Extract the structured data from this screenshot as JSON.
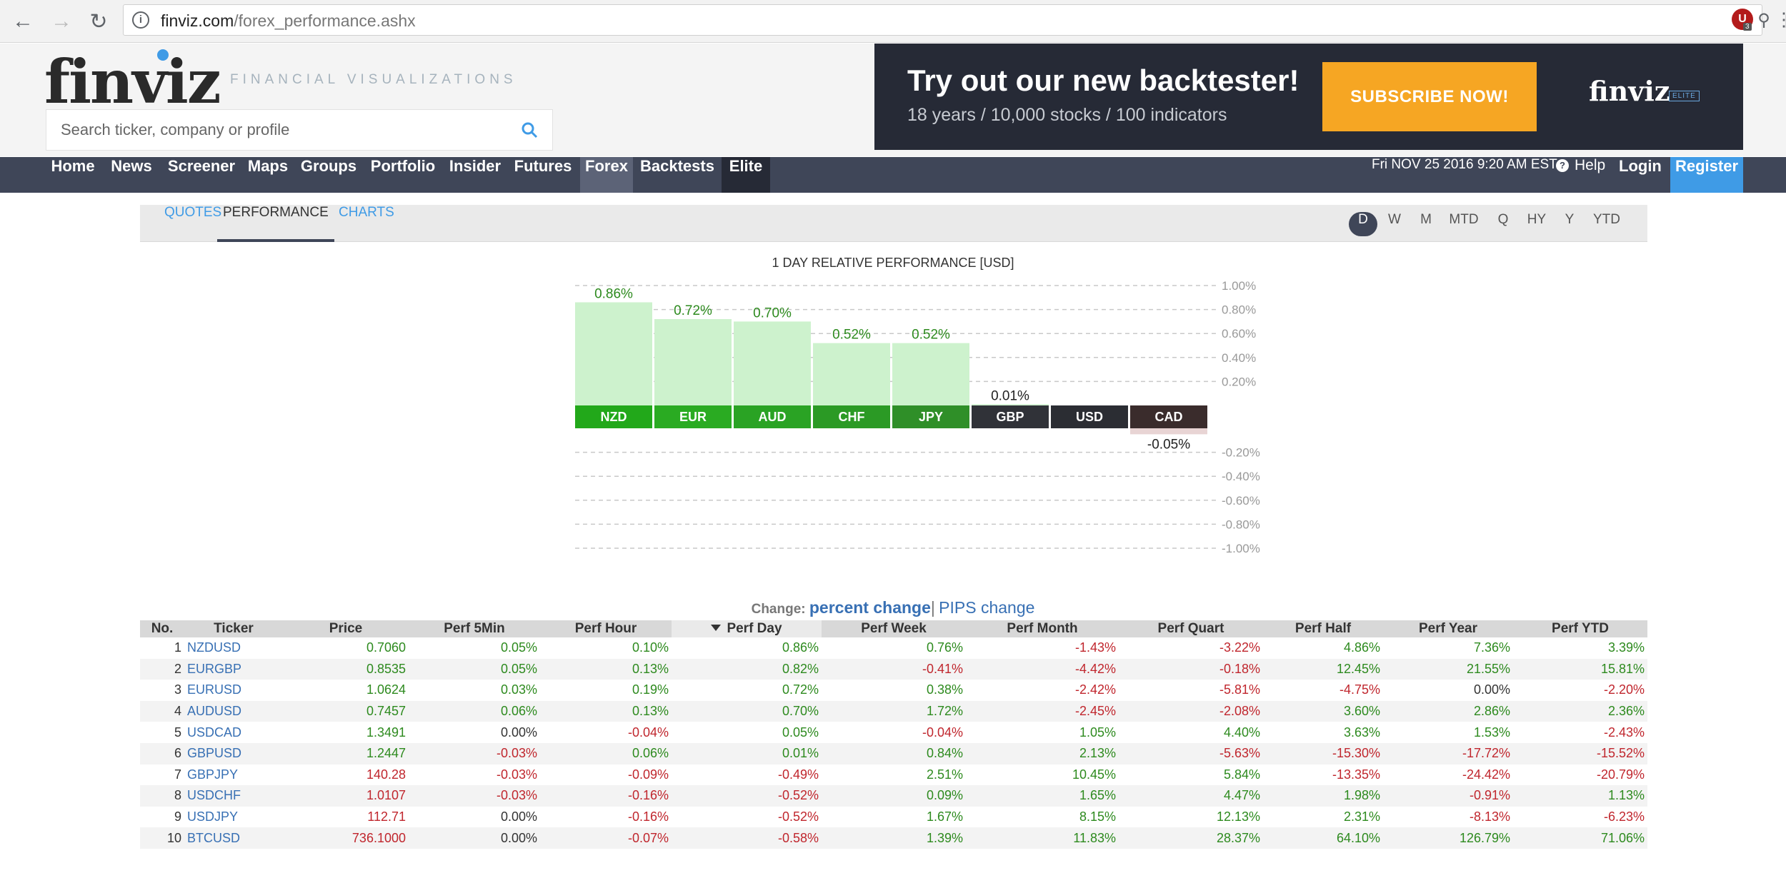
{
  "browser": {
    "url_host": "finviz.com",
    "url_path": "/forex_performance.ashx"
  },
  "header": {
    "logo": "finviz",
    "tagline": "FINANCIAL VISUALIZATIONS",
    "search_placeholder": "Search ticker, company or profile",
    "banner": {
      "title": "Try out our new backtester!",
      "subtitle": "18 years / 10,000 stocks / 100 indicators",
      "button": "SUBSCRIBE NOW!",
      "logo": "finviz",
      "elite": "ELITE"
    }
  },
  "nav": {
    "items": [
      "Home",
      "News",
      "Screener",
      "Maps",
      "Groups",
      "Portfolio",
      "Insider",
      "Futures",
      "Forex",
      "Backtests",
      "Elite"
    ],
    "date": "Fri NOV 25 2016 9:20 AM EST",
    "help": "Help",
    "login": "Login",
    "register": "Register"
  },
  "subtabs": {
    "items": [
      "QUOTES",
      "PERFORMANCE",
      "CHARTS"
    ],
    "periods": [
      "D",
      "W",
      "M",
      "MTD",
      "Q",
      "HY",
      "Y",
      "YTD"
    ]
  },
  "colors": {
    "positive": "#2d8a1e",
    "negative": "#c0262d",
    "accent": "#3f9be6",
    "nav_bg": "#3f4658"
  },
  "chart_data": {
    "type": "bar",
    "title": "1 DAY RELATIVE PERFORMANCE  [USD]",
    "categories": [
      "NZD",
      "EUR",
      "AUD",
      "CHF",
      "JPY",
      "GBP",
      "USD",
      "CAD"
    ],
    "values": [
      0.86,
      0.72,
      0.7,
      0.52,
      0.52,
      0.01,
      0.0,
      -0.05
    ],
    "labels": [
      "0.86%",
      "0.72%",
      "0.70%",
      "0.52%",
      "0.52%",
      "0.01%",
      "",
      "-0.05%"
    ],
    "yticks": [
      "1.00%",
      "0.80%",
      "0.60%",
      "0.40%",
      "0.20%",
      "-0.20%",
      "-0.40%",
      "-0.60%",
      "-0.80%",
      "-1.00%"
    ],
    "ylim": [
      -1.0,
      1.0
    ],
    "grid": true
  },
  "change_line": {
    "label": "Change:",
    "active": "percent change",
    "separator": "|",
    "other": "PIPS change"
  },
  "table": {
    "headers": [
      "No.",
      "Ticker",
      "Price",
      "Perf 5Min",
      "Perf Hour",
      "Perf Day",
      "Perf Week",
      "Perf Month",
      "Perf Quart",
      "Perf Half",
      "Perf Year",
      "Perf YTD"
    ],
    "rows": [
      [
        "1",
        "NZDUSD",
        "0.7060",
        "0.05%",
        "0.10%",
        "0.86%",
        "0.76%",
        "-1.43%",
        "-3.22%",
        "4.86%",
        "7.36%",
        "3.39%"
      ],
      [
        "2",
        "EURGBP",
        "0.8535",
        "0.05%",
        "0.13%",
        "0.82%",
        "-0.41%",
        "-4.42%",
        "-0.18%",
        "12.45%",
        "21.55%",
        "15.81%"
      ],
      [
        "3",
        "EURUSD",
        "1.0624",
        "0.03%",
        "0.19%",
        "0.72%",
        "0.38%",
        "-2.42%",
        "-5.81%",
        "-4.75%",
        "0.00%",
        "-2.20%"
      ],
      [
        "4",
        "AUDUSD",
        "0.7457",
        "0.06%",
        "0.13%",
        "0.70%",
        "1.72%",
        "-2.45%",
        "-2.08%",
        "3.60%",
        "2.86%",
        "2.36%"
      ],
      [
        "5",
        "USDCAD",
        "1.3491",
        "0.00%",
        "-0.04%",
        "0.05%",
        "-0.04%",
        "1.05%",
        "4.40%",
        "3.63%",
        "1.53%",
        "-2.43%"
      ],
      [
        "6",
        "GBPUSD",
        "1.2447",
        "-0.03%",
        "0.06%",
        "0.01%",
        "0.84%",
        "2.13%",
        "-5.63%",
        "-15.30%",
        "-17.72%",
        "-15.52%"
      ],
      [
        "7",
        "GBPJPY",
        "140.28",
        "-0.03%",
        "-0.09%",
        "-0.49%",
        "2.51%",
        "10.45%",
        "5.84%",
        "-13.35%",
        "-24.42%",
        "-20.79%"
      ],
      [
        "8",
        "USDCHF",
        "1.0107",
        "-0.03%",
        "-0.16%",
        "-0.52%",
        "0.09%",
        "1.65%",
        "4.47%",
        "1.98%",
        "-0.91%",
        "1.13%"
      ],
      [
        "9",
        "USDJPY",
        "112.71",
        "0.00%",
        "-0.16%",
        "-0.52%",
        "1.67%",
        "8.15%",
        "12.13%",
        "2.31%",
        "-8.13%",
        "-6.23%"
      ],
      [
        "10",
        "BTCUSD",
        "736.1000",
        "0.00%",
        "-0.07%",
        "-0.58%",
        "1.39%",
        "11.83%",
        "28.37%",
        "64.10%",
        "126.79%",
        "71.06%"
      ]
    ]
  }
}
